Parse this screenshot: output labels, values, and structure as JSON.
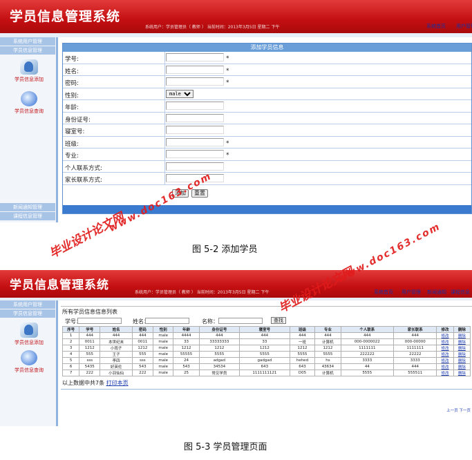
{
  "figure1": {
    "app_title": "学员信息管理系统",
    "header_info": "系统用户：学员管理员（ 教师 ）  当前时间：2013年3月5日  星期二  下午",
    "header_links": [
      "系统首页",
      "用户管理"
    ],
    "sidebar_heads": [
      "系统用户管理",
      "学员信息管理"
    ],
    "sidebar_items": [
      "学员信息添加",
      "学员信息查询"
    ],
    "sidebar_footer": [
      "新闻通知管理",
      "课程信息管理"
    ],
    "panel_title": "添加学员信息",
    "fields": [
      {
        "label": "学号:",
        "required": "*"
      },
      {
        "label": "姓名:",
        "required": "*"
      },
      {
        "label": "密码:",
        "required": "*"
      },
      {
        "label": "性别:",
        "select": "male"
      },
      {
        "label": "年龄:",
        "required": ""
      },
      {
        "label": "身份证号:",
        "required": ""
      },
      {
        "label": "寝室号:",
        "required": ""
      },
      {
        "label": "班级:",
        "required": "*"
      },
      {
        "label": "专业:",
        "required": "*"
      },
      {
        "label": "个人联系方式:",
        "required": ""
      },
      {
        "label": "家长联系方式:",
        "required": ""
      }
    ],
    "buttons": {
      "add": "添加",
      "reset": "重置"
    },
    "caption": "图 5-2  添加学员"
  },
  "figure2": {
    "app_title": "学员信息管理系统",
    "header_info": "系统用户：学员管理员（ 教师 ）  当前时间：2013年3月5日  星期二  下午",
    "header_links": [
      "系统首页",
      "用户管理",
      "新闻通知",
      "课程信息"
    ],
    "sidebar_heads": [
      "系统用户管理",
      "学员信息管理"
    ],
    "sidebar_items": [
      "学员信息添加",
      "学员信息查询"
    ],
    "list_title": "所有学员信息信息列表",
    "search": {
      "label_id": "学号：",
      "label_name": "姓名：",
      "label_class": "名称：",
      "button": "查找"
    },
    "columns": [
      "序号",
      "学号",
      "姓名",
      "密码",
      "性别",
      "年龄",
      "身份证号",
      "寝室号",
      "班级",
      "专业",
      "个人联系",
      "家长联系",
      "修改",
      "删除"
    ],
    "rows": [
      [
        "1",
        "444",
        "444",
        "444",
        "male",
        "4444",
        "444",
        "444",
        "444",
        "444",
        "444",
        "444",
        "修改",
        "删除"
      ],
      [
        "2",
        "0011",
        "本世纪末",
        "0011",
        "male",
        "33",
        "33333333",
        "33",
        "一班",
        "计算机",
        "000-0000022",
        "000-00000",
        "修改",
        "删除"
      ],
      [
        "3",
        "1212",
        "小雨子",
        "1212",
        "male",
        "1212",
        "1212",
        "1212",
        "1212",
        "1212",
        "1111111",
        "1111111",
        "修改",
        "删除"
      ],
      [
        "4",
        "555",
        "王子",
        "555",
        "male",
        "55555",
        "5555",
        "5555",
        "5555",
        "5555",
        "222222",
        "22222",
        "修改",
        "删除"
      ],
      [
        "5",
        "sss",
        "李四",
        "sss",
        "male",
        "24",
        "adgad",
        "gadgad",
        "hehed",
        "hs",
        "3333",
        "3333",
        "修改",
        "删除"
      ],
      [
        "6",
        "5435",
        "好英伦",
        "543",
        "male",
        "543",
        "34534",
        "643",
        "643",
        "43634",
        "44",
        "444",
        "修改",
        "删除"
      ],
      [
        "7",
        "222",
        "小羽仙仙",
        "222",
        "male",
        "25",
        "常见学员",
        "1111111121",
        "D05",
        "计算机",
        "5555",
        "555511",
        "修改",
        "删除"
      ]
    ],
    "pager": "上一页  下一页",
    "footer_text": "以上数据中共7条",
    "print_link": "打印本页",
    "caption": "图 5-3 学员管理页面"
  },
  "watermarks": [
    "毕业设计论文网",
    "www.doc163.com"
  ],
  "colors": {
    "header_red": "#c40f12",
    "accent_blue": "#3a7bd0",
    "link_blue": "#1a3ab0"
  }
}
